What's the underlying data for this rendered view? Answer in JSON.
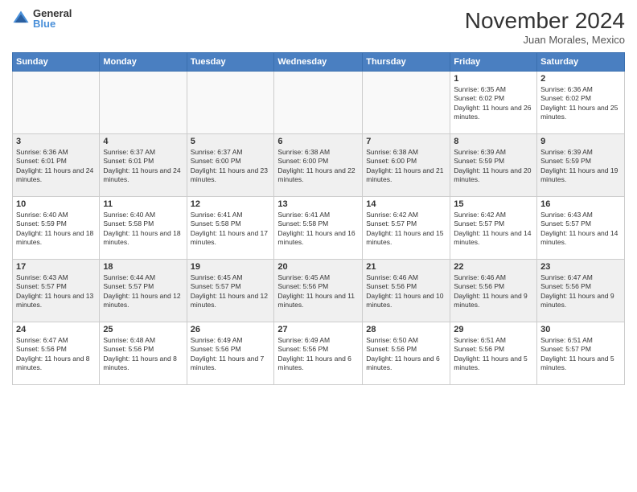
{
  "header": {
    "logo_general": "General",
    "logo_blue": "Blue",
    "month_title": "November 2024",
    "subtitle": "Juan Morales, Mexico"
  },
  "weekdays": [
    "Sunday",
    "Monday",
    "Tuesday",
    "Wednesday",
    "Thursday",
    "Friday",
    "Saturday"
  ],
  "weeks": [
    [
      {
        "day": "",
        "info": ""
      },
      {
        "day": "",
        "info": ""
      },
      {
        "day": "",
        "info": ""
      },
      {
        "day": "",
        "info": ""
      },
      {
        "day": "",
        "info": ""
      },
      {
        "day": "1",
        "info": "Sunrise: 6:35 AM\nSunset: 6:02 PM\nDaylight: 11 hours and 26 minutes."
      },
      {
        "day": "2",
        "info": "Sunrise: 6:36 AM\nSunset: 6:02 PM\nDaylight: 11 hours and 25 minutes."
      }
    ],
    [
      {
        "day": "3",
        "info": "Sunrise: 6:36 AM\nSunset: 6:01 PM\nDaylight: 11 hours and 24 minutes."
      },
      {
        "day": "4",
        "info": "Sunrise: 6:37 AM\nSunset: 6:01 PM\nDaylight: 11 hours and 24 minutes."
      },
      {
        "day": "5",
        "info": "Sunrise: 6:37 AM\nSunset: 6:00 PM\nDaylight: 11 hours and 23 minutes."
      },
      {
        "day": "6",
        "info": "Sunrise: 6:38 AM\nSunset: 6:00 PM\nDaylight: 11 hours and 22 minutes."
      },
      {
        "day": "7",
        "info": "Sunrise: 6:38 AM\nSunset: 6:00 PM\nDaylight: 11 hours and 21 minutes."
      },
      {
        "day": "8",
        "info": "Sunrise: 6:39 AM\nSunset: 5:59 PM\nDaylight: 11 hours and 20 minutes."
      },
      {
        "day": "9",
        "info": "Sunrise: 6:39 AM\nSunset: 5:59 PM\nDaylight: 11 hours and 19 minutes."
      }
    ],
    [
      {
        "day": "10",
        "info": "Sunrise: 6:40 AM\nSunset: 5:59 PM\nDaylight: 11 hours and 18 minutes."
      },
      {
        "day": "11",
        "info": "Sunrise: 6:40 AM\nSunset: 5:58 PM\nDaylight: 11 hours and 18 minutes."
      },
      {
        "day": "12",
        "info": "Sunrise: 6:41 AM\nSunset: 5:58 PM\nDaylight: 11 hours and 17 minutes."
      },
      {
        "day": "13",
        "info": "Sunrise: 6:41 AM\nSunset: 5:58 PM\nDaylight: 11 hours and 16 minutes."
      },
      {
        "day": "14",
        "info": "Sunrise: 6:42 AM\nSunset: 5:57 PM\nDaylight: 11 hours and 15 minutes."
      },
      {
        "day": "15",
        "info": "Sunrise: 6:42 AM\nSunset: 5:57 PM\nDaylight: 11 hours and 14 minutes."
      },
      {
        "day": "16",
        "info": "Sunrise: 6:43 AM\nSunset: 5:57 PM\nDaylight: 11 hours and 14 minutes."
      }
    ],
    [
      {
        "day": "17",
        "info": "Sunrise: 6:43 AM\nSunset: 5:57 PM\nDaylight: 11 hours and 13 minutes."
      },
      {
        "day": "18",
        "info": "Sunrise: 6:44 AM\nSunset: 5:57 PM\nDaylight: 11 hours and 12 minutes."
      },
      {
        "day": "19",
        "info": "Sunrise: 6:45 AM\nSunset: 5:57 PM\nDaylight: 11 hours and 12 minutes."
      },
      {
        "day": "20",
        "info": "Sunrise: 6:45 AM\nSunset: 5:56 PM\nDaylight: 11 hours and 11 minutes."
      },
      {
        "day": "21",
        "info": "Sunrise: 6:46 AM\nSunset: 5:56 PM\nDaylight: 11 hours and 10 minutes."
      },
      {
        "day": "22",
        "info": "Sunrise: 6:46 AM\nSunset: 5:56 PM\nDaylight: 11 hours and 9 minutes."
      },
      {
        "day": "23",
        "info": "Sunrise: 6:47 AM\nSunset: 5:56 PM\nDaylight: 11 hours and 9 minutes."
      }
    ],
    [
      {
        "day": "24",
        "info": "Sunrise: 6:47 AM\nSunset: 5:56 PM\nDaylight: 11 hours and 8 minutes."
      },
      {
        "day": "25",
        "info": "Sunrise: 6:48 AM\nSunset: 5:56 PM\nDaylight: 11 hours and 8 minutes."
      },
      {
        "day": "26",
        "info": "Sunrise: 6:49 AM\nSunset: 5:56 PM\nDaylight: 11 hours and 7 minutes."
      },
      {
        "day": "27",
        "info": "Sunrise: 6:49 AM\nSunset: 5:56 PM\nDaylight: 11 hours and 6 minutes."
      },
      {
        "day": "28",
        "info": "Sunrise: 6:50 AM\nSunset: 5:56 PM\nDaylight: 11 hours and 6 minutes."
      },
      {
        "day": "29",
        "info": "Sunrise: 6:51 AM\nSunset: 5:56 PM\nDaylight: 11 hours and 5 minutes."
      },
      {
        "day": "30",
        "info": "Sunrise: 6:51 AM\nSunset: 5:57 PM\nDaylight: 11 hours and 5 minutes."
      }
    ]
  ]
}
